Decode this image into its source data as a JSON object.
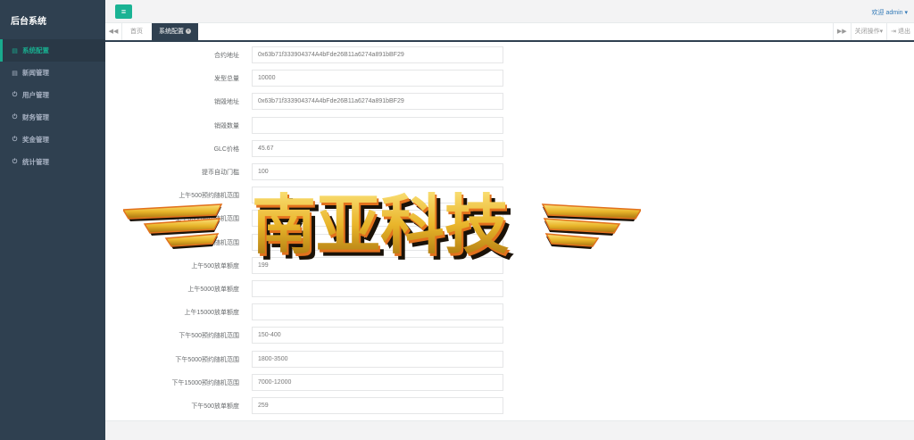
{
  "sidebar": {
    "brand": "后台系统",
    "items": [
      {
        "label": "系统配置",
        "icon": "doc-icon",
        "active": true
      },
      {
        "label": "新闻管理",
        "icon": "doc-icon",
        "active": false
      },
      {
        "label": "用户管理",
        "icon": "power-icon",
        "active": false
      },
      {
        "label": "财务管理",
        "icon": "power-icon",
        "active": false
      },
      {
        "label": "奖金管理",
        "icon": "power-icon",
        "active": false
      },
      {
        "label": "统计管理",
        "icon": "power-icon",
        "active": false
      }
    ]
  },
  "topbar": {
    "menu_icon": "hamburger-icon",
    "welcome": "欢迎 admin ▾"
  },
  "tabs": {
    "prev_icon": "double-left-icon",
    "next_icon": "double-right-icon",
    "items": [
      {
        "label": "首页",
        "active": false
      },
      {
        "label": "系统配置",
        "active": true
      }
    ],
    "close_ops": "关闭操作▾",
    "logout": "退出"
  },
  "form": {
    "fields": [
      {
        "label": "合约地址",
        "value": "0x63b71f333904374A4bFde26B11a6274a891bBF29"
      },
      {
        "label": "发型总量",
        "value": "10000"
      },
      {
        "label": "销毁地址",
        "value": "0x63b71f333904374A4bFde26B11a6274a891bBF29"
      },
      {
        "label": "销毁数量",
        "value": ""
      },
      {
        "label": "GLC价格",
        "value": "45.67"
      },
      {
        "label": "提币自动门槛",
        "value": "100"
      },
      {
        "label": "上午500预约随机范围",
        "value": ""
      },
      {
        "label": "上午5000预约随机范围",
        "value": ""
      },
      {
        "label": "上午15000预约随机范围",
        "value": ""
      },
      {
        "label": "上午500放单额度",
        "value": "199"
      },
      {
        "label": "上午5000放单额度",
        "value": ""
      },
      {
        "label": "上午15000放单额度",
        "value": ""
      },
      {
        "label": "下午500预约随机范围",
        "value": "150-400"
      },
      {
        "label": "下午5000预约随机范围",
        "value": "1800-3500"
      },
      {
        "label": "下午15000预约随机范围",
        "value": "7000-12000"
      },
      {
        "label": "下午500放单额度",
        "value": "259"
      }
    ]
  },
  "watermark": {
    "text": "南亚科技",
    "colors": {
      "gold": "#f2c230",
      "orange": "#e2711d",
      "dark": "#1a1208"
    }
  },
  "colors": {
    "sidebar_bg": "#2f4050",
    "accent": "#1ab394",
    "link": "#337ab7"
  }
}
